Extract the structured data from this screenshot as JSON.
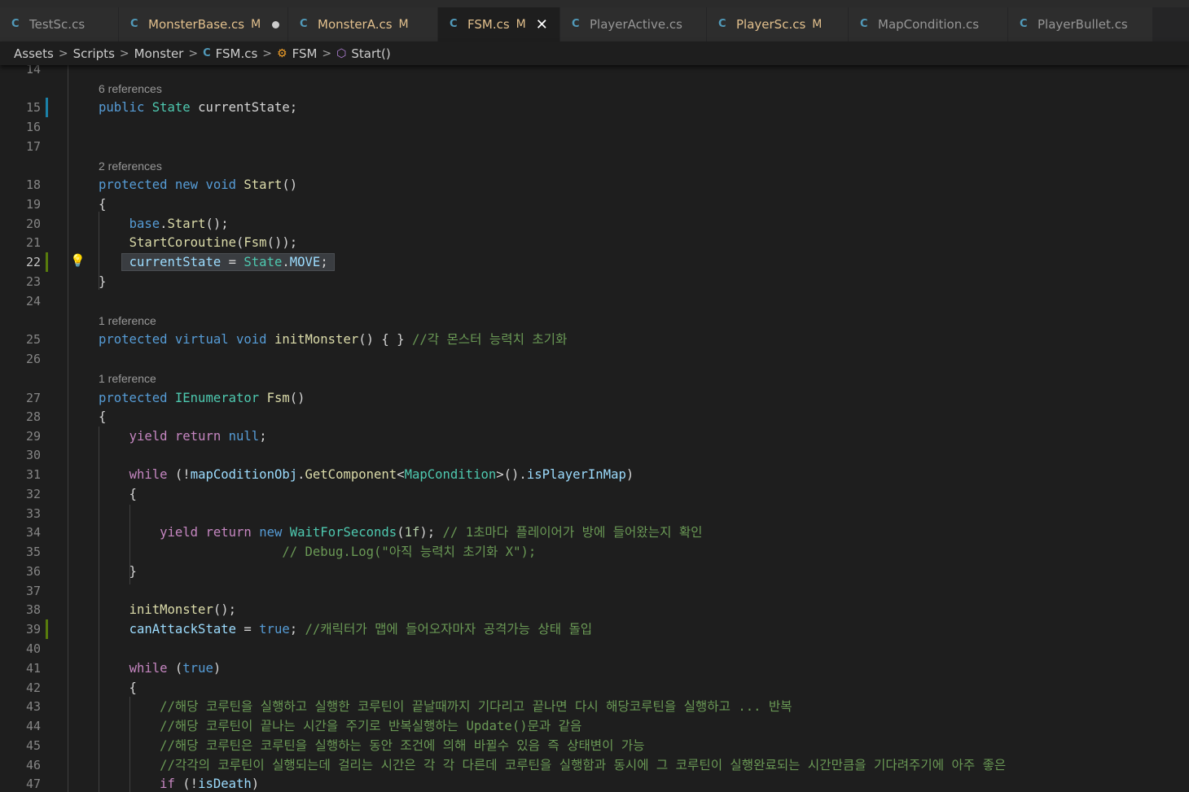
{
  "tabs": [
    {
      "label": "TestSc.cs",
      "modified": false,
      "active": false,
      "unsaved": false
    },
    {
      "label": "MonsterBase.cs",
      "modified": true,
      "active": false,
      "unsaved": true
    },
    {
      "label": "MonsterA.cs",
      "modified": true,
      "active": false,
      "unsaved": false
    },
    {
      "label": "FSM.cs",
      "modified": true,
      "active": true,
      "unsaved": false
    },
    {
      "label": "PlayerActive.cs",
      "modified": false,
      "active": false,
      "unsaved": false
    },
    {
      "label": "PlayerSc.cs",
      "modified": true,
      "active": false,
      "unsaved": false
    },
    {
      "label": "MapCondition.cs",
      "modified": false,
      "active": false,
      "unsaved": false
    },
    {
      "label": "PlayerBullet.cs",
      "modified": false,
      "active": false,
      "unsaved": false
    }
  ],
  "modified_flag": "M",
  "close_glyph": "✕",
  "breadcrumb": {
    "items": [
      "Assets",
      "Scripts",
      "Monster",
      "FSM.cs",
      "FSM",
      "Start()"
    ],
    "separator": ">"
  },
  "codelens": {
    "l15": "6 references",
    "l18": "2 references",
    "l25": "1 reference",
    "l27": "1 reference"
  },
  "line_numbers": [
    "14",
    "15",
    "16",
    "17",
    "18",
    "19",
    "20",
    "21",
    "22",
    "23",
    "24",
    "25",
    "26",
    "27",
    "28",
    "29",
    "30",
    "31",
    "32",
    "33",
    "34",
    "35",
    "36",
    "37",
    "38",
    "39",
    "40",
    "41",
    "42",
    "43",
    "44",
    "45",
    "46",
    "47"
  ],
  "current_line": "22",
  "code": {
    "l15": [
      [
        "k",
        "public"
      ],
      [
        "p",
        " "
      ],
      [
        "t",
        "State"
      ],
      [
        "p",
        " currentState;"
      ]
    ],
    "l18": [
      [
        "k",
        "protected"
      ],
      [
        "p",
        " "
      ],
      [
        "k",
        "new"
      ],
      [
        "p",
        " "
      ],
      [
        "k",
        "void"
      ],
      [
        "p",
        " "
      ],
      [
        "f",
        "Start"
      ],
      [
        "p",
        "()"
      ]
    ],
    "l19": [
      [
        "p",
        "{"
      ]
    ],
    "l20": [
      [
        "p",
        "    "
      ],
      [
        "k",
        "base"
      ],
      [
        "p",
        "."
      ],
      [
        "f",
        "Start"
      ],
      [
        "p",
        "();"
      ]
    ],
    "l21": [
      [
        "p",
        "    "
      ],
      [
        "f",
        "StartCoroutine"
      ],
      [
        "p",
        "("
      ],
      [
        "f",
        "Fsm"
      ],
      [
        "p",
        "());"
      ]
    ],
    "l22": [
      [
        "p",
        "    "
      ],
      [
        "v",
        "currentState"
      ],
      [
        "p",
        " = "
      ],
      [
        "t",
        "State"
      ],
      [
        "p",
        "."
      ],
      [
        "v",
        "MOVE"
      ],
      [
        "p",
        ";"
      ]
    ],
    "l23": [
      [
        "p",
        "}"
      ]
    ],
    "l25": [
      [
        "k",
        "protected"
      ],
      [
        "p",
        " "
      ],
      [
        "k",
        "virtual"
      ],
      [
        "p",
        " "
      ],
      [
        "k",
        "void"
      ],
      [
        "p",
        " "
      ],
      [
        "f",
        "initMonster"
      ],
      [
        "p",
        "() { } "
      ],
      [
        "cm",
        "//각 몬스터 능력치 초기화"
      ]
    ],
    "l27": [
      [
        "k",
        "protected"
      ],
      [
        "p",
        " "
      ],
      [
        "t",
        "IEnumerator"
      ],
      [
        "p",
        " "
      ],
      [
        "f",
        "Fsm"
      ],
      [
        "p",
        "()"
      ]
    ],
    "l28": [
      [
        "p",
        "{"
      ]
    ],
    "l29": [
      [
        "p",
        "    "
      ],
      [
        "c",
        "yield"
      ],
      [
        "p",
        " "
      ],
      [
        "c",
        "return"
      ],
      [
        "p",
        " "
      ],
      [
        "k",
        "null"
      ],
      [
        "p",
        ";"
      ]
    ],
    "l31": [
      [
        "p",
        "    "
      ],
      [
        "c",
        "while"
      ],
      [
        "p",
        " (!"
      ],
      [
        "v",
        "mapCoditionObj"
      ],
      [
        "p",
        "."
      ],
      [
        "f",
        "GetComponent"
      ],
      [
        "p",
        "<"
      ],
      [
        "t",
        "MapCondition"
      ],
      [
        "p",
        ">()."
      ],
      [
        "v",
        "isPlayerInMap"
      ],
      [
        "p",
        ")"
      ]
    ],
    "l32": [
      [
        "p",
        "    {"
      ]
    ],
    "l34": [
      [
        "p",
        "        "
      ],
      [
        "c",
        "yield"
      ],
      [
        "p",
        " "
      ],
      [
        "c",
        "return"
      ],
      [
        "p",
        " "
      ],
      [
        "k",
        "new"
      ],
      [
        "p",
        " "
      ],
      [
        "t",
        "WaitForSeconds"
      ],
      [
        "p",
        "("
      ],
      [
        "n",
        "1f"
      ],
      [
        "p",
        "); "
      ],
      [
        "cm",
        "// 1초마다 플레이어가 방에 들어왔는지 확인"
      ]
    ],
    "l35": [
      [
        "p",
        "                  "
      ],
      [
        "cm",
        "      // Debug.Log(\"아직 능력치 초기화 X\");"
      ]
    ],
    "l36": [
      [
        "p",
        "    }"
      ]
    ],
    "l38": [
      [
        "p",
        "    "
      ],
      [
        "f",
        "initMonster"
      ],
      [
        "p",
        "();"
      ]
    ],
    "l39": [
      [
        "p",
        "    "
      ],
      [
        "v",
        "canAttackState"
      ],
      [
        "p",
        " = "
      ],
      [
        "k",
        "true"
      ],
      [
        "p",
        "; "
      ],
      [
        "cm",
        "//캐릭터가 맵에 들어오자마자 공격가능 상태 돌입"
      ]
    ],
    "l41": [
      [
        "p",
        "    "
      ],
      [
        "c",
        "while"
      ],
      [
        "p",
        " ("
      ],
      [
        "k",
        "true"
      ],
      [
        "p",
        ")"
      ]
    ],
    "l42": [
      [
        "p",
        "    {"
      ]
    ],
    "l43": [
      [
        "p",
        "        "
      ],
      [
        "cm",
        "//해당 코루틴을 실행하고 실행한 코루틴이 끝날때까지 기다리고 끝나면 다시 해당코루틴을 실행하고 ... 반복"
      ]
    ],
    "l44": [
      [
        "p",
        "        "
      ],
      [
        "cm",
        "//해당 코루틴이 끝나는 시간을 주기로 반복실행하는 Update()문과 같음"
      ]
    ],
    "l45": [
      [
        "p",
        "        "
      ],
      [
        "cm",
        "//해당 코루틴은 코루틴을 실행하는 동안 조건에 의해 바뀔수 있음 즉 상태변이 가능"
      ]
    ],
    "l46": [
      [
        "p",
        "        "
      ],
      [
        "cm",
        "//각각의 코루틴이 실행되는데 걸리는 시간은 각 각 다른데 코루틴을 실행함과 동시에 그 코루틴이 실행완료되는 시간만큼을 기다려주기에 아주 좋은"
      ]
    ],
    "l47": [
      [
        "p",
        "        "
      ],
      [
        "c",
        "if"
      ],
      [
        "p",
        " (!"
      ],
      [
        "v",
        "isDeath"
      ],
      [
        "p",
        ")"
      ]
    ]
  },
  "colors": {
    "keyword": "#569cd6",
    "control": "#c586c0",
    "type": "#4ec9b0",
    "function": "#dcdcaa",
    "variable": "#9cdcfe",
    "number": "#b5cea8",
    "comment": "#6a9955",
    "modified": "#e2c08d"
  },
  "icons": {
    "tab": "csharp-icon",
    "bc_file": "csharp-icon",
    "bc_class": "class-icon",
    "bc_method": "method-icon",
    "lightbulb": "lightbulb-icon"
  }
}
